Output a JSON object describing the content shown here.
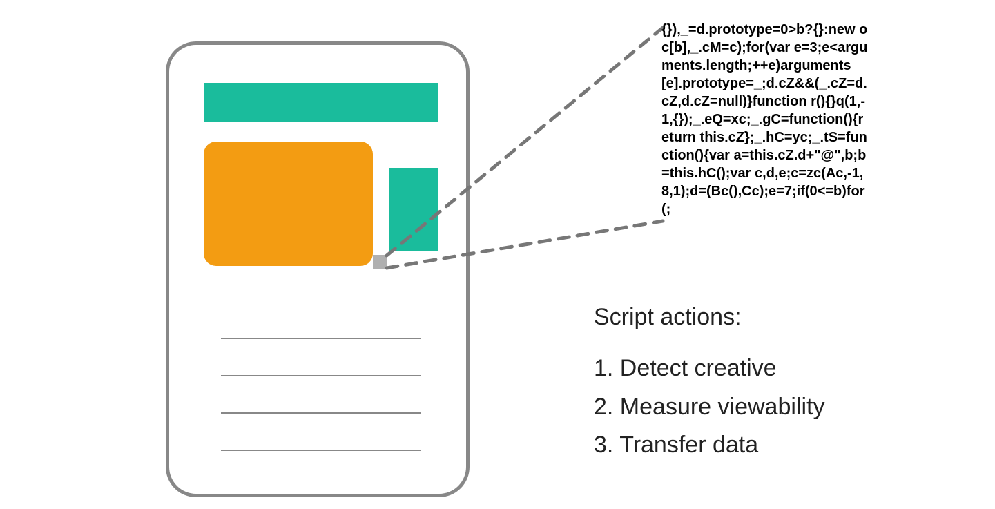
{
  "code_snippet": "{}),_=d.prototype=0>b?{}:new oc[b],_.cM=c);for(var e=3;e<arguments.length;++e)arguments[e].prototype=_;d.cZ&&(_.cZ=d.cZ,d.cZ=null)}function r(){}q(1,-1,{});_.eQ=xc;_.gC=function(){return this.cZ};_.hC=yc;_.tS=function(){var a=this.cZ.d+\"@\",b;b=this.hC();var c,d,e;c=zc(Ac,-1,8,1);d=(Bc(),Cc);e=7;if(0<=b)for(;",
  "actions": {
    "heading": "Script actions:",
    "items": [
      "1. Detect creative",
      "2. Measure viewability",
      "3. Transfer data"
    ]
  },
  "colors": {
    "teal": "#1abc9c",
    "orange": "#f39c12",
    "grey": "#888888",
    "pixel": "#b0b0b0"
  }
}
